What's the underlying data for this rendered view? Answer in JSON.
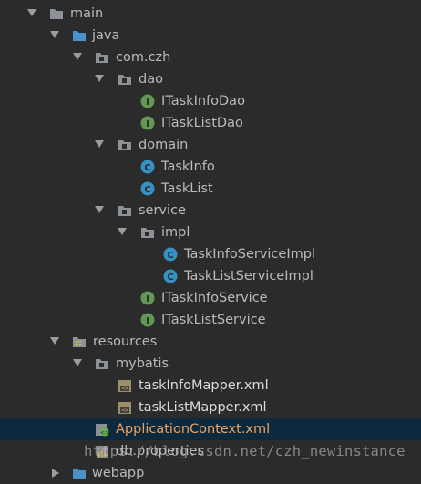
{
  "colors": {
    "background": "#2b2b2b",
    "selection": "#0d293e",
    "text": "#bbbbbb",
    "xml_text": "#f0a35e",
    "interface_badge": "#629755",
    "class_badge": "#3592c4",
    "folder": "#8c9298",
    "source_folder": "#4a90c9"
  },
  "tree": [
    {
      "label": "main",
      "icon": "folder-icon",
      "expanded": true
    },
    {
      "label": "java",
      "icon": "source-folder-icon",
      "expanded": true
    },
    {
      "label": "com.czh",
      "icon": "package-icon",
      "expanded": true
    },
    {
      "label": "dao",
      "icon": "package-icon",
      "expanded": true
    },
    {
      "label": "ITaskInfoDao",
      "icon": "interface-icon"
    },
    {
      "label": "ITaskListDao",
      "icon": "interface-icon"
    },
    {
      "label": "domain",
      "icon": "package-icon",
      "expanded": true
    },
    {
      "label": "TaskInfo",
      "icon": "class-icon"
    },
    {
      "label": "TaskList",
      "icon": "class-icon"
    },
    {
      "label": "service",
      "icon": "package-icon",
      "expanded": true
    },
    {
      "label": "impl",
      "icon": "package-icon",
      "expanded": true
    },
    {
      "label": "TaskInfoServiceImpl",
      "icon": "class-icon"
    },
    {
      "label": "TaskListServiceImpl",
      "icon": "class-icon"
    },
    {
      "label": "ITaskInfoService",
      "icon": "interface-icon"
    },
    {
      "label": "ITaskListService",
      "icon": "interface-icon"
    },
    {
      "label": "resources",
      "icon": "resources-folder-icon",
      "expanded": true
    },
    {
      "label": "mybatis",
      "icon": "package-icon",
      "expanded": true
    },
    {
      "label": "taskInfoMapper.xml",
      "icon": "xml-file-icon"
    },
    {
      "label": "taskListMapper.xml",
      "icon": "xml-file-icon"
    },
    {
      "label": "ApplicationContext.xml",
      "icon": "spring-xml-icon",
      "selected": true
    },
    {
      "label": "db.properties",
      "icon": "properties-file-icon"
    },
    {
      "label": "webapp",
      "icon": "web-folder-icon",
      "expanded": false
    }
  ],
  "watermark": "https://blog.csdn.net/czh_newinstance"
}
